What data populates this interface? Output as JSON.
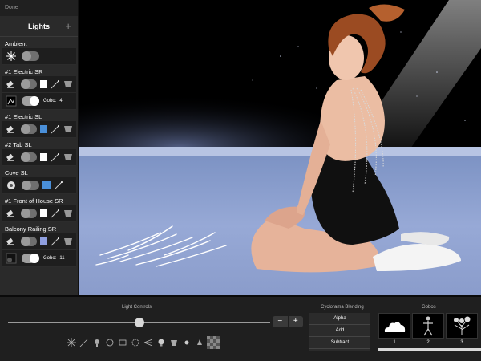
{
  "topbar": {
    "done_label": "Done"
  },
  "panel": {
    "title": "Lights",
    "add_symbol": "+",
    "lights": [
      {
        "label": "Ambient"
      },
      {
        "label": "#1 Electric SR",
        "color": "#ffffff",
        "gobo_label": "Gobo:",
        "gobo_value": "4"
      },
      {
        "label": "#1 Electric SL",
        "color": "#4a8fd8"
      },
      {
        "label": "#2 Tab SL",
        "color": "#ffffff"
      },
      {
        "label": "Cove SL",
        "color": "#4a8fd8"
      },
      {
        "label": "#1 Front of House SR",
        "color": "#ffffff"
      },
      {
        "label": "Balcony Railing SR",
        "color": "#8f9fe0",
        "gobo_label": "Gobo:",
        "gobo_value": "11"
      }
    ]
  },
  "bottom": {
    "light_controls_title": "Light Controls",
    "slider_value": 0.5,
    "stepper": {
      "minus": "−",
      "plus": "+"
    },
    "blending_title": "Cyclorama Blending",
    "blending_options": [
      "Alpha",
      "Add",
      "Subtract"
    ],
    "gobos_title": "Gobos",
    "gobo_numbers": [
      "1",
      "2",
      "3"
    ]
  },
  "tool_icons": [
    "starburst-icon",
    "magic-wand-icon",
    "spotlight-icon",
    "rotate-icon",
    "diffuser-icon",
    "rotate-light-icon",
    "fan-beam-icon",
    "bulb-icon",
    "cone-icon",
    "bulb-small-icon",
    "lamp-icon",
    "texture-icon"
  ],
  "colors": {
    "panel_bg": "#2a2a2a",
    "accent_blue": "#4a8fd8",
    "floor": "#8aa0d0"
  }
}
